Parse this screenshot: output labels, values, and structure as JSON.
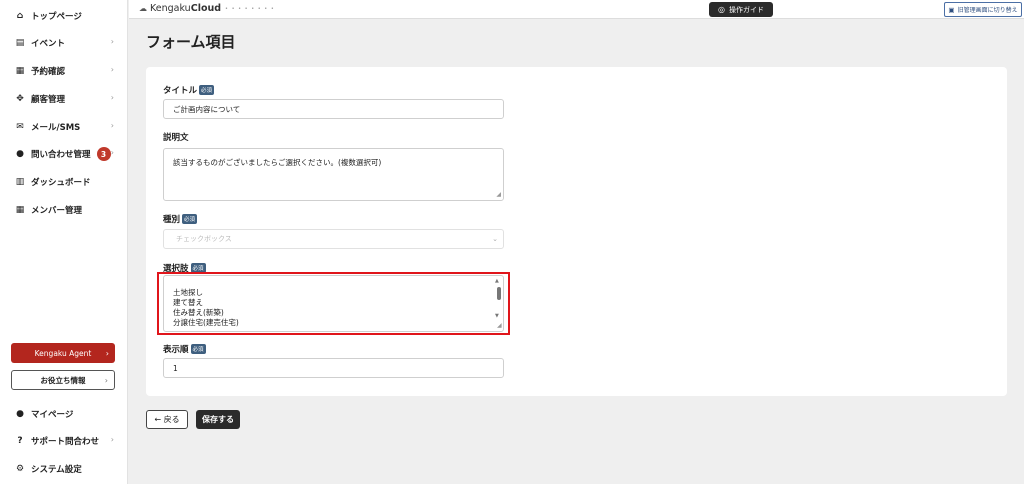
{
  "sidebar": {
    "items": [
      {
        "label": "トップページ",
        "icon": "home-icon",
        "glyph": "⌂",
        "chevron": ""
      },
      {
        "label": "イベント",
        "icon": "document-icon",
        "glyph": "▤",
        "chevron": "›"
      },
      {
        "label": "予約確認",
        "icon": "calendar-icon",
        "glyph": "▦",
        "chevron": "›"
      },
      {
        "label": "顧客管理",
        "icon": "users-icon",
        "glyph": "✥",
        "chevron": "›"
      },
      {
        "label": "メール/SMS",
        "icon": "mail-icon",
        "glyph": "✉",
        "chevron": "›"
      },
      {
        "label": "問い合わせ管理",
        "icon": "chat-icon",
        "glyph": "●",
        "chevron": "›",
        "badge": "3"
      },
      {
        "label": "ダッシュボード",
        "icon": "chart-icon",
        "glyph": "▥",
        "chevron": ""
      },
      {
        "label": "メンバー管理",
        "icon": "grid-icon",
        "glyph": "▦",
        "chevron": ""
      }
    ],
    "agent_button": {
      "label": "Kengaku Agent",
      "chevron": "›"
    },
    "info_button": {
      "label": "お役立ち情報",
      "chevron": "›"
    },
    "bottom_items": [
      {
        "label": "マイページ",
        "icon": "person-icon",
        "glyph": "●",
        "chevron": ""
      },
      {
        "label": "サポート問合わせ",
        "icon": "help-icon",
        "glyph": "?",
        "chevron": "›"
      },
      {
        "label": "システム設定",
        "icon": "gear-icon",
        "glyph": "⚙",
        "chevron": ""
      }
    ]
  },
  "header": {
    "logo_prefix": "Kengaku",
    "logo_bold": "Cloud",
    "logo_dots": "• • • • • • • •",
    "guide_label": "操作ガイド",
    "switch_label": "旧管理画面に切り替え"
  },
  "page": {
    "title": "フォーム項目"
  },
  "form": {
    "required_badge": "必須",
    "title_label": "タイトル",
    "title_value": "ご計画内容について",
    "description_label": "説明文",
    "description_value": "該当するものがございましたらご選択ください。(複数選択可)",
    "type_label": "種別",
    "type_value": "チェックボックス",
    "options_label": "選択肢",
    "options": [
      "土地探し",
      "建て替え",
      "住み替え(新築)",
      "分譲住宅(建売住宅)"
    ],
    "order_label": "表示順",
    "order_value": "1"
  },
  "actions": {
    "back_label": "← 戻る",
    "save_label": "保存する"
  }
}
